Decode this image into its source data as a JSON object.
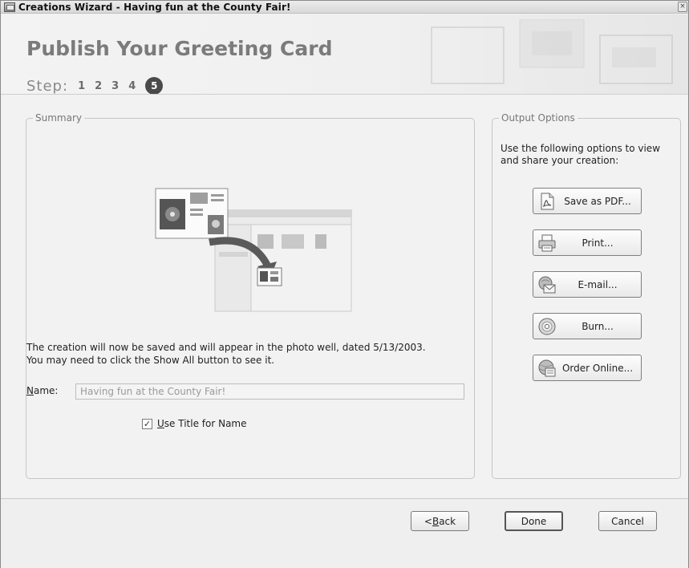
{
  "window": {
    "title": "Creations Wizard - Having fun at the County Fair!",
    "close_glyph": "×"
  },
  "header": {
    "title": "Publish Your Greeting Card",
    "step_label": "Step:",
    "steps": [
      "1",
      "2",
      "3",
      "4",
      "5"
    ],
    "active_step": "5"
  },
  "summary": {
    "group_label": "Summary",
    "illustration_icon": "publish-to-photo-well-illustration",
    "line1": "The creation will now be saved and will appear in the photo well, dated 5/13/2003.",
    "line2": "You may need to click the Show All button to see it.",
    "name_label_prefix": "N",
    "name_label_rest": "ame:",
    "name_value": "Having fun at the County Fair!",
    "use_title_checked": true,
    "use_title_label_prefix": "U",
    "use_title_label_rest": "se Title for Name",
    "checkmark": "✓"
  },
  "output": {
    "group_label": "Output Options",
    "description": "Use the following options to view and share your creation:",
    "buttons": [
      {
        "label": "Save as PDF...",
        "icon": "pdf-icon"
      },
      {
        "label": "Print...",
        "icon": "printer-icon"
      },
      {
        "label": "E-mail...",
        "icon": "email-icon"
      },
      {
        "label": "Burn...",
        "icon": "cd-icon"
      },
      {
        "label": "Order Online...",
        "icon": "globe-icon"
      }
    ]
  },
  "footer": {
    "back_prefix": "< ",
    "back_accel": "B",
    "back_rest": "ack",
    "done": "Done",
    "cancel": "Cancel"
  },
  "colors": {
    "window_bg": "#f2f2f2",
    "header_title": "#7b7b7b",
    "active_step_bg": "#4a4a4a"
  }
}
